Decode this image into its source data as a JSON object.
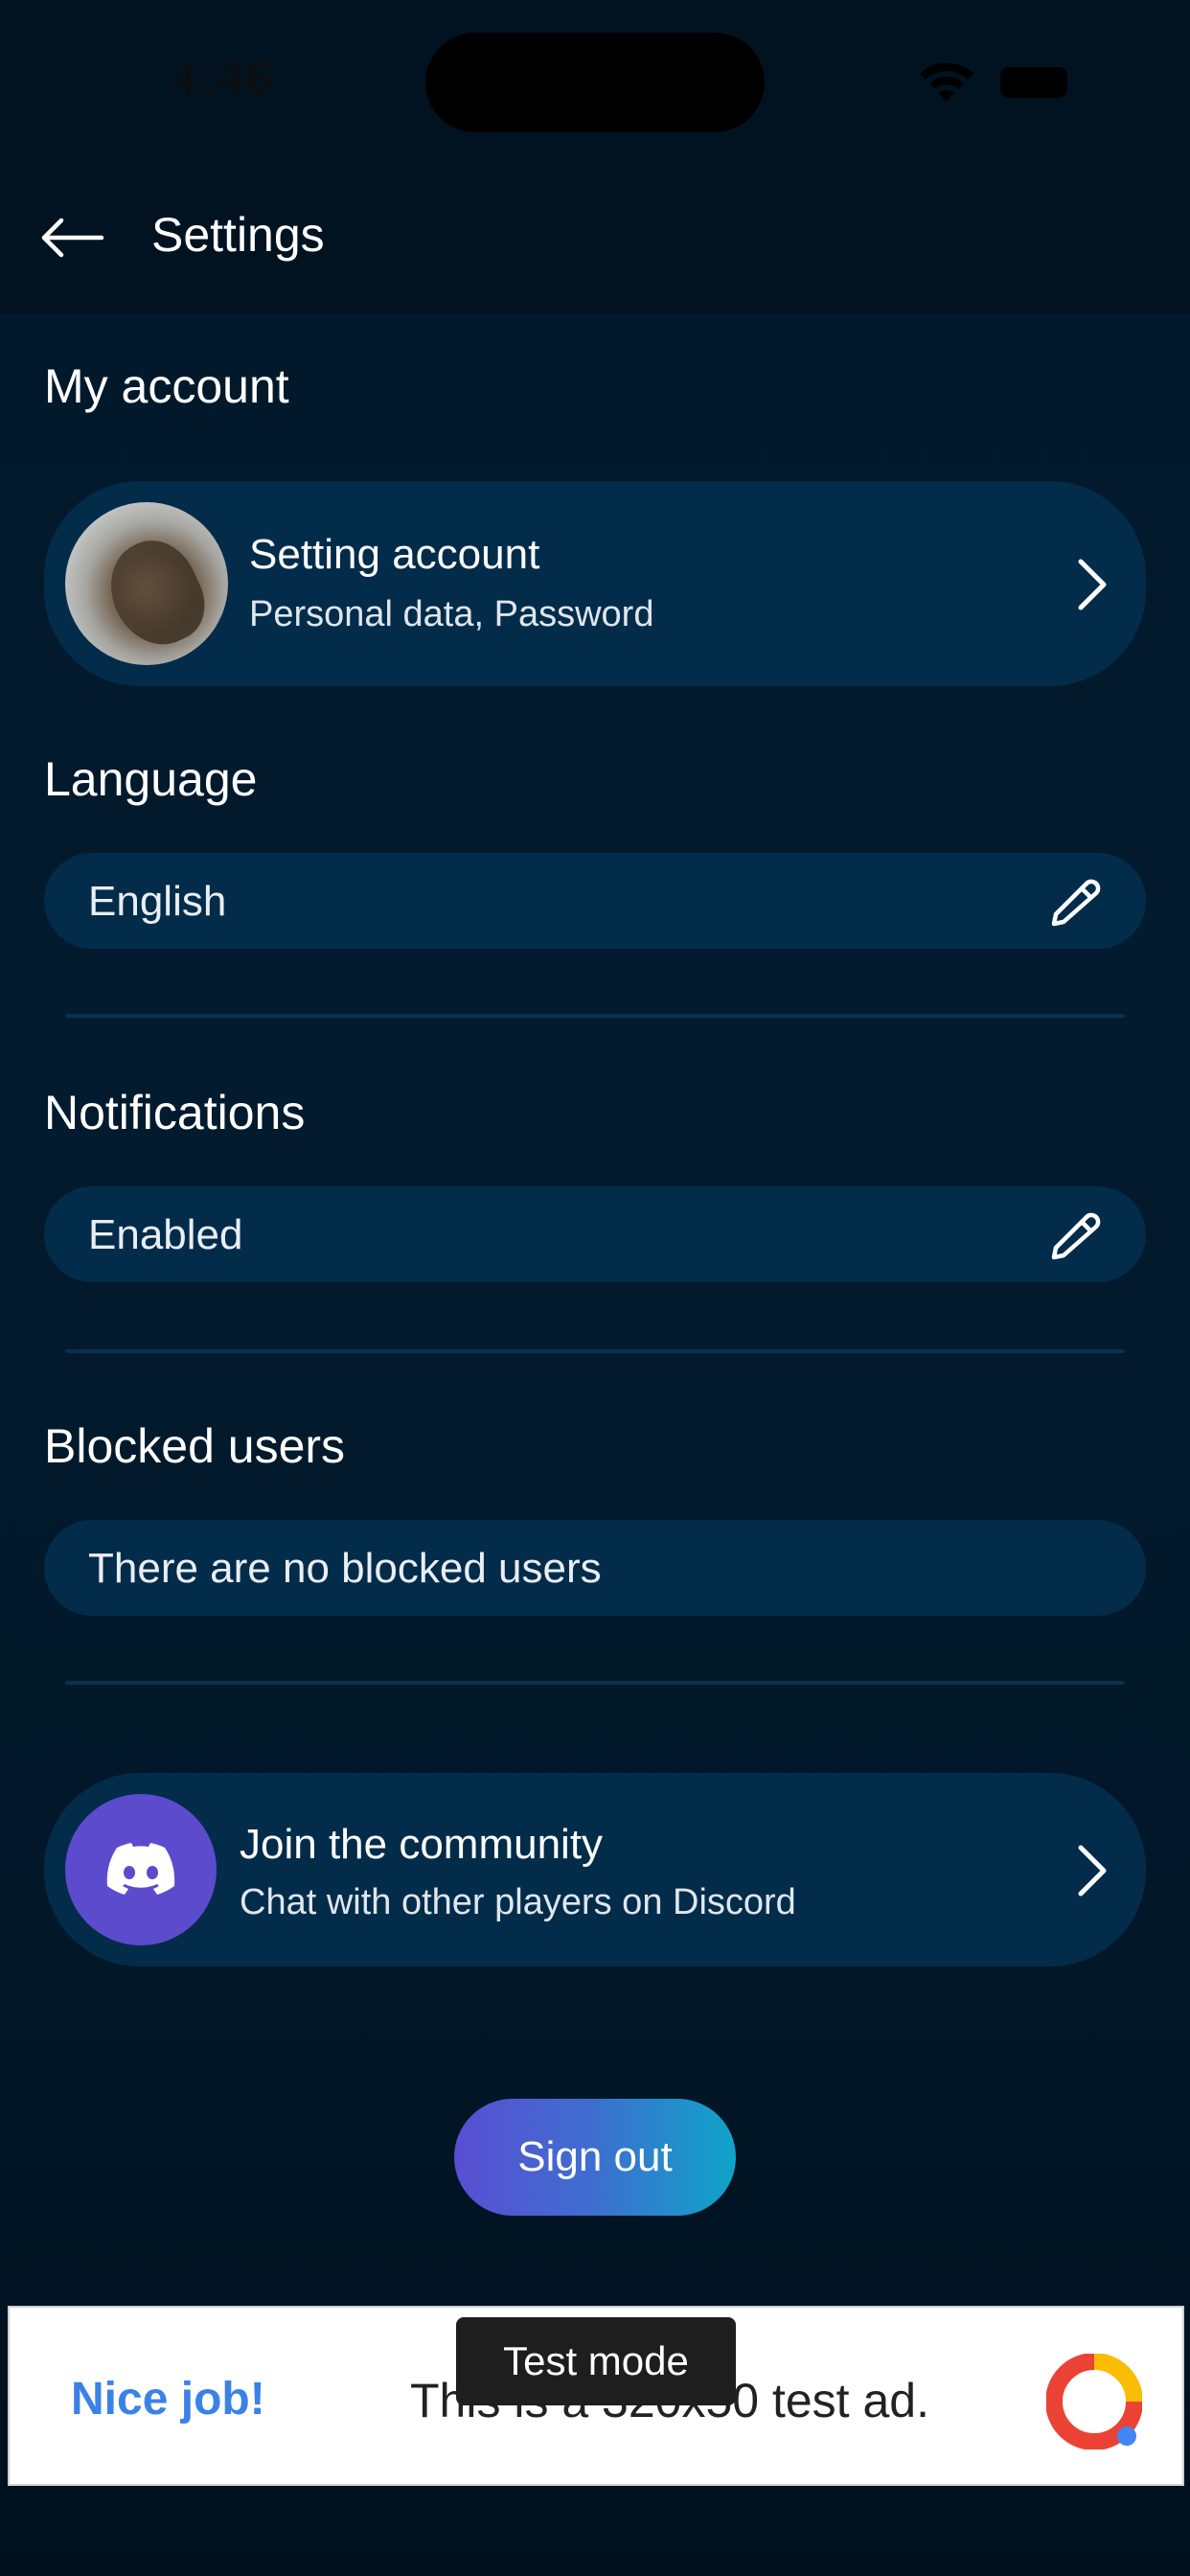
{
  "status_bar": {
    "time": "4:46"
  },
  "header": {
    "title": "Settings"
  },
  "sections": {
    "account": {
      "title": "My account",
      "card_title": "Setting account",
      "card_subtitle": "Personal data, Password"
    },
    "language": {
      "title": "Language",
      "value": "English"
    },
    "notifications": {
      "title": "Notifications",
      "value": "Enabled"
    },
    "blocked_users": {
      "title": "Blocked users",
      "value": "There are no blocked users"
    },
    "community": {
      "title": "Join the community",
      "subtitle": "Chat with other players on Discord"
    }
  },
  "actions": {
    "sign_out": "Sign out"
  },
  "ad": {
    "nice_job": "Nice job!",
    "text": "This is a 320x50 test ad.",
    "badge": "Test mode"
  },
  "colors": {
    "background": "#021829",
    "card": "#032c4b",
    "discord": "#5c4bcd",
    "signout_gradient_start": "#5a4ed3",
    "signout_gradient_end": "#0fa4c8"
  },
  "icons": [
    "back-arrow-icon",
    "chevron-right-icon",
    "pencil-icon",
    "discord-icon",
    "wifi-icon",
    "battery-icon"
  ]
}
